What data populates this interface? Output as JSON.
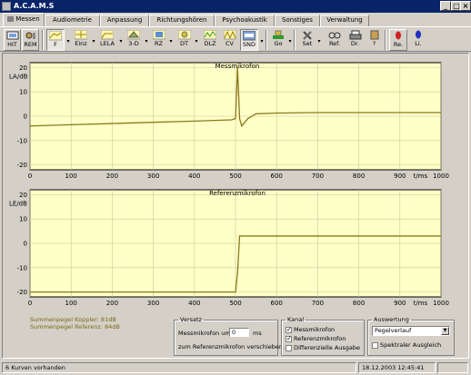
{
  "window": {
    "title": "A.C.A.M.S"
  },
  "tabs": [
    {
      "label": "Messen"
    },
    {
      "label": "Audiometrie"
    },
    {
      "label": "Anpassung"
    },
    {
      "label": "Richtungshören"
    },
    {
      "label": "Psychoakustik"
    },
    {
      "label": "Sonstiges"
    },
    {
      "label": "Verwaltung"
    }
  ],
  "toolbar": [
    {
      "label": "HIT",
      "icon": "hit-icon"
    },
    {
      "label": "REM",
      "icon": "rem-icon"
    },
    {
      "label": "F",
      "icon": "curve-f-icon"
    },
    {
      "label": "Einz",
      "icon": "einz-icon"
    },
    {
      "label": "LELA",
      "icon": "lela-icon"
    },
    {
      "label": "3-D",
      "icon": "3d-icon"
    },
    {
      "label": "RZ",
      "icon": "rz-icon"
    },
    {
      "label": "DT",
      "icon": "dt-icon"
    },
    {
      "label": "DLZ",
      "icon": "dlz-icon"
    },
    {
      "label": "CV",
      "icon": "cv-icon"
    },
    {
      "label": "SND",
      "icon": "snd-icon"
    },
    {
      "label": "Go",
      "icon": "go-icon"
    },
    {
      "label": "Set",
      "icon": "tools-icon"
    },
    {
      "label": "Ref.",
      "icon": "glasses-icon"
    },
    {
      "label": "Dr.",
      "icon": "printer-icon"
    },
    {
      "label": "?",
      "icon": "help-icon"
    },
    {
      "label": "Re.",
      "icon": "right-ear-icon"
    },
    {
      "label": "Li.",
      "icon": "left-ear-icon"
    }
  ],
  "chart_data": [
    {
      "type": "line",
      "title": "Messmikrofon",
      "ylabel": "LA/dB",
      "xlabel": "t/ms",
      "xlim": [
        0,
        1000
      ],
      "ylim": [
        -22,
        22
      ],
      "xticks": [
        0,
        100,
        200,
        300,
        400,
        500,
        600,
        700,
        800,
        900,
        1000
      ],
      "yticks": [
        20,
        10,
        0,
        -10,
        -20
      ],
      "grid": true,
      "line_color": "#8c7a1c",
      "background": "#ffffc8",
      "series": [
        {
          "x": [
            0,
            100,
            200,
            300,
            400,
            490,
            500,
            505,
            510,
            515,
            520,
            530,
            540,
            550,
            600,
            700,
            800,
            900,
            1000
          ],
          "y": [
            -4,
            -3.5,
            -3,
            -2.5,
            -2,
            -1.5,
            -1,
            20,
            -1,
            -4,
            -3,
            -1,
            0,
            1,
            1.3,
            1.5,
            1.5,
            1.5,
            1.5
          ]
        }
      ]
    },
    {
      "type": "line",
      "title": "Referenzmikrofon",
      "ylabel": "LE/dB",
      "xlabel": "t/ms",
      "xlim": [
        0,
        1000
      ],
      "ylim": [
        -22,
        22
      ],
      "xticks": [
        0,
        100,
        200,
        300,
        400,
        500,
        600,
        700,
        800,
        900,
        1000
      ],
      "yticks": [
        20,
        10,
        0,
        -10,
        -20
      ],
      "grid": true,
      "line_color": "#8c7a1c",
      "background": "#ffffc8",
      "series": [
        {
          "x": [
            0,
            100,
            200,
            300,
            400,
            500,
            505,
            510,
            520,
            600,
            700,
            800,
            900,
            1000
          ],
          "y": [
            -20,
            -20,
            -20,
            -20,
            -20,
            -20,
            -12,
            3,
            3,
            3,
            3,
            3,
            3,
            3
          ]
        }
      ]
    }
  ],
  "summary": {
    "line1": "Summenpegel Koppler: 81dB",
    "line2": "Summenpegel Referenz: 84dB"
  },
  "versatz": {
    "legend": "Versatz",
    "label": "Messmikrofon um:",
    "value": "0",
    "unit": "ms",
    "label2": "zum Referenzmikrofon verschieben."
  },
  "kanal": {
    "legend": "Kanal",
    "options": [
      {
        "label": "Messmikrofon",
        "checked": true
      },
      {
        "label": "Referenzmikrofon",
        "checked": true
      },
      {
        "label": "Differenzielle Ausgabe",
        "checked": false
      }
    ]
  },
  "auswertung": {
    "legend": "Auswertung",
    "selected": "Pegelverlauf",
    "checkbox_label": "Spektraler Ausgleich",
    "checkbox_checked": false
  },
  "status": {
    "left": "6 Kurven vorhanden",
    "right": "18.12.2003 12:45:41"
  }
}
